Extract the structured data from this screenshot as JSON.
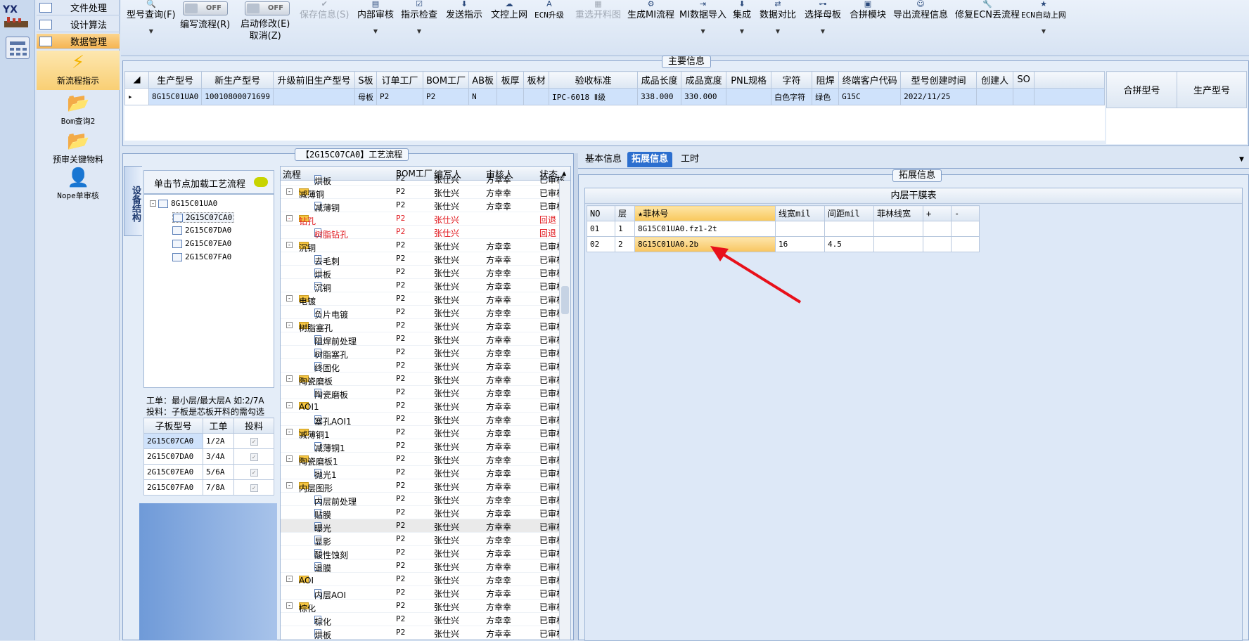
{
  "app": {
    "logo_text": "YX"
  },
  "nav": {
    "items": [
      {
        "label": "文件处理"
      },
      {
        "label": "设计算法"
      },
      {
        "label": "数据管理"
      }
    ],
    "big": [
      {
        "label": "新流程指示",
        "icon": "lightning-icon"
      },
      {
        "label": "Bom查询2",
        "icon": "folder-icon"
      },
      {
        "label": "预审关键物料",
        "icon": "folder-icon"
      },
      {
        "label": "Nope单审核",
        "icon": "user-icon"
      }
    ]
  },
  "toolbar": {
    "items": [
      {
        "label": "型号查询(F)"
      },
      {
        "label": "编写流程(R)",
        "toggle": "OFF"
      },
      {
        "label": "启动修改(E)",
        "label2": "取消(Z)",
        "toggle": "OFF"
      },
      {
        "label": "保存信息(S)"
      },
      {
        "label": "内部审核"
      },
      {
        "label": "指示检查"
      },
      {
        "label": "发送指示"
      },
      {
        "label": "文控上网"
      },
      {
        "label": "ECN升级"
      },
      {
        "label": "重选开料图"
      },
      {
        "label": "生成MI流程"
      },
      {
        "label": "MI数据导入"
      },
      {
        "label": "集成"
      },
      {
        "label": "数据对比"
      },
      {
        "label": "选择母板"
      },
      {
        "label": "合拼模块"
      },
      {
        "label": "导出流程信息"
      },
      {
        "label": "修复ECN丢流程"
      },
      {
        "label": "ECN自动上网"
      }
    ]
  },
  "main_info": {
    "title": "主要信息",
    "columns": [
      "生产型号",
      "新生产型号",
      "升级前旧生产型号",
      "S板",
      "订单工厂",
      "BOM工厂",
      "AB板",
      "板厚",
      "板材",
      "验收标准",
      "成品长度",
      "成品宽度",
      "PNL规格",
      "字符",
      "阻焊",
      "终端客户代码",
      "型号创建时间",
      "创建人",
      "SO"
    ],
    "row": [
      "8G15C01UA0",
      "10010800071699",
      "",
      "母板",
      "P2",
      "P2",
      "N",
      "",
      "",
      "IPC-6018 Ⅱ级",
      "338.000",
      "330.000",
      "",
      "白色字符",
      "绿色",
      "G15C",
      "2022/11/25",
      "",
      ""
    ],
    "side_columns": [
      "合拼型号",
      "生产型号"
    ]
  },
  "process": {
    "title": "【2G15C07CA0】工艺流程",
    "vtab": "设备结构",
    "hint": "单击节点加载工艺流程",
    "tree_root": "8G15C01UA0",
    "tree_children": [
      "2G15C07CA0",
      "2G15C07DA0",
      "2G15C07EA0",
      "2G15C07FA0"
    ],
    "summary1": "工单：最小层/最大层A 如:2/7A",
    "summary2": "投料：子板是芯板开料的需勾选",
    "sub_columns": [
      "子板型号",
      "工单",
      "投料"
    ],
    "sub_rows": [
      [
        "2G15C07CA0",
        "1/2A"
      ],
      [
        "2G15C07DA0",
        "3/4A"
      ],
      [
        "2G15C07EA0",
        "5/6A"
      ],
      [
        "2G15C07FA0",
        "7/8A"
      ]
    ],
    "grid_columns": [
      "流程",
      "BOM工厂",
      "编写人",
      "审核人",
      "状态"
    ],
    "rows": [
      {
        "name": "烘板",
        "level": 2,
        "bom": "P2",
        "writer": "张仕兴",
        "reviewer": "方幸幸",
        "status": "已审核"
      },
      {
        "name": "减薄铜",
        "level": 1,
        "bom": "P2",
        "writer": "张仕兴",
        "reviewer": "方幸幸",
        "status": "已审核"
      },
      {
        "name": "减薄铜",
        "level": 2,
        "bom": "P2",
        "writer": "张仕兴",
        "reviewer": "方幸幸",
        "status": "已审核"
      },
      {
        "name": "钻孔",
        "level": 1,
        "bom": "P2",
        "writer": "张仕兴",
        "reviewer": "",
        "status": "回退",
        "red": true
      },
      {
        "name": "树脂钻孔",
        "level": 2,
        "bom": "P2",
        "writer": "张仕兴",
        "reviewer": "",
        "status": "回退",
        "red": true
      },
      {
        "name": "沉铜",
        "level": 1,
        "bom": "P2",
        "writer": "张仕兴",
        "reviewer": "方幸幸",
        "status": "已审核"
      },
      {
        "name": "去毛刺",
        "level": 2,
        "bom": "P2",
        "writer": "张仕兴",
        "reviewer": "方幸幸",
        "status": "已审核"
      },
      {
        "name": "烘板",
        "level": 2,
        "bom": "P2",
        "writer": "张仕兴",
        "reviewer": "方幸幸",
        "status": "已审核"
      },
      {
        "name": "沉铜",
        "level": 2,
        "bom": "P2",
        "writer": "张仕兴",
        "reviewer": "方幸幸",
        "status": "已审核"
      },
      {
        "name": "电镀",
        "level": 1,
        "bom": "P2",
        "writer": "张仕兴",
        "reviewer": "方幸幸",
        "status": "已审核"
      },
      {
        "name": "负片电镀",
        "level": 2,
        "bom": "P2",
        "writer": "张仕兴",
        "reviewer": "方幸幸",
        "status": "已审核"
      },
      {
        "name": "树脂塞孔",
        "level": 1,
        "bom": "P2",
        "writer": "张仕兴",
        "reviewer": "方幸幸",
        "status": "已审核"
      },
      {
        "name": "阻焊前处理",
        "level": 2,
        "bom": "P2",
        "writer": "张仕兴",
        "reviewer": "方幸幸",
        "status": "已审核"
      },
      {
        "name": "树脂塞孔",
        "level": 2,
        "bom": "P2",
        "writer": "张仕兴",
        "reviewer": "方幸幸",
        "status": "已审核"
      },
      {
        "name": "终固化",
        "level": 2,
        "bom": "P2",
        "writer": "张仕兴",
        "reviewer": "方幸幸",
        "status": "已审核"
      },
      {
        "name": "陶瓷磨板",
        "level": 1,
        "bom": "P2",
        "writer": "张仕兴",
        "reviewer": "方幸幸",
        "status": "已审核"
      },
      {
        "name": "陶瓷磨板",
        "level": 2,
        "bom": "P2",
        "writer": "张仕兴",
        "reviewer": "方幸幸",
        "status": "已审核"
      },
      {
        "name": "AOI1",
        "level": 1,
        "bom": "P2",
        "writer": "张仕兴",
        "reviewer": "方幸幸",
        "status": "已审核"
      },
      {
        "name": "塞孔AOI1",
        "level": 2,
        "bom": "P2",
        "writer": "张仕兴",
        "reviewer": "方幸幸",
        "status": "已审核"
      },
      {
        "name": "减薄铜1",
        "level": 1,
        "bom": "P2",
        "writer": "张仕兴",
        "reviewer": "方幸幸",
        "status": "已审核"
      },
      {
        "name": "减薄铜1",
        "level": 2,
        "bom": "P2",
        "writer": "张仕兴",
        "reviewer": "方幸幸",
        "status": "已审核"
      },
      {
        "name": "陶瓷磨板1",
        "level": 1,
        "bom": "P2",
        "writer": "张仕兴",
        "reviewer": "方幸幸",
        "status": "已审核"
      },
      {
        "name": "抛光1",
        "level": 2,
        "bom": "P2",
        "writer": "张仕兴",
        "reviewer": "方幸幸",
        "status": "已审核"
      },
      {
        "name": "内层图形",
        "level": 1,
        "bom": "P2",
        "writer": "张仕兴",
        "reviewer": "方幸幸",
        "status": "已审核"
      },
      {
        "name": "内层前处理",
        "level": 2,
        "bom": "P2",
        "writer": "张仕兴",
        "reviewer": "方幸幸",
        "status": "已审核"
      },
      {
        "name": "贴膜",
        "level": 2,
        "bom": "P2",
        "writer": "张仕兴",
        "reviewer": "方幸幸",
        "status": "已审核"
      },
      {
        "name": "曝光",
        "level": 2,
        "bom": "P2",
        "writer": "张仕兴",
        "reviewer": "方幸幸",
        "status": "已审核",
        "sel": true
      },
      {
        "name": "显影",
        "level": 2,
        "bom": "P2",
        "writer": "张仕兴",
        "reviewer": "方幸幸",
        "status": "已审核"
      },
      {
        "name": "酸性蚀刻",
        "level": 2,
        "bom": "P2",
        "writer": "张仕兴",
        "reviewer": "方幸幸",
        "status": "已审核"
      },
      {
        "name": "退膜",
        "level": 2,
        "bom": "P2",
        "writer": "张仕兴",
        "reviewer": "方幸幸",
        "status": "已审核"
      },
      {
        "name": "AOI",
        "level": 1,
        "bom": "P2",
        "writer": "张仕兴",
        "reviewer": "方幸幸",
        "status": "已审核"
      },
      {
        "name": "内层AOI",
        "level": 2,
        "bom": "P2",
        "writer": "张仕兴",
        "reviewer": "方幸幸",
        "status": "已审核"
      },
      {
        "name": "棕化",
        "level": 1,
        "bom": "P2",
        "writer": "张仕兴",
        "reviewer": "方幸幸",
        "status": "已审核"
      },
      {
        "name": "棕化",
        "level": 2,
        "bom": "P2",
        "writer": "张仕兴",
        "reviewer": "方幸幸",
        "status": "已审核"
      },
      {
        "name": "烘板",
        "level": 2,
        "bom": "P2",
        "writer": "张仕兴",
        "reviewer": "方幸幸",
        "status": "已审核"
      }
    ]
  },
  "right": {
    "tabs": [
      "基本信息",
      "拓展信息",
      "工时"
    ],
    "active_tab": "拓展信息",
    "ext_title": "拓展信息",
    "table_title": "内层干膜表",
    "columns": [
      "NO",
      "层",
      "★菲林号",
      "线宽mil",
      "间距mil",
      "菲林线宽",
      "+",
      "-"
    ],
    "rows": [
      [
        "01",
        "1",
        "8G15C01UA0.fz1-2t",
        "",
        "",
        "",
        "",
        ""
      ],
      [
        "02",
        "2",
        "8G15C01UA0.2b",
        "16",
        "4.5",
        "",
        "",
        ""
      ]
    ],
    "arrow_color": "#e8101a"
  }
}
